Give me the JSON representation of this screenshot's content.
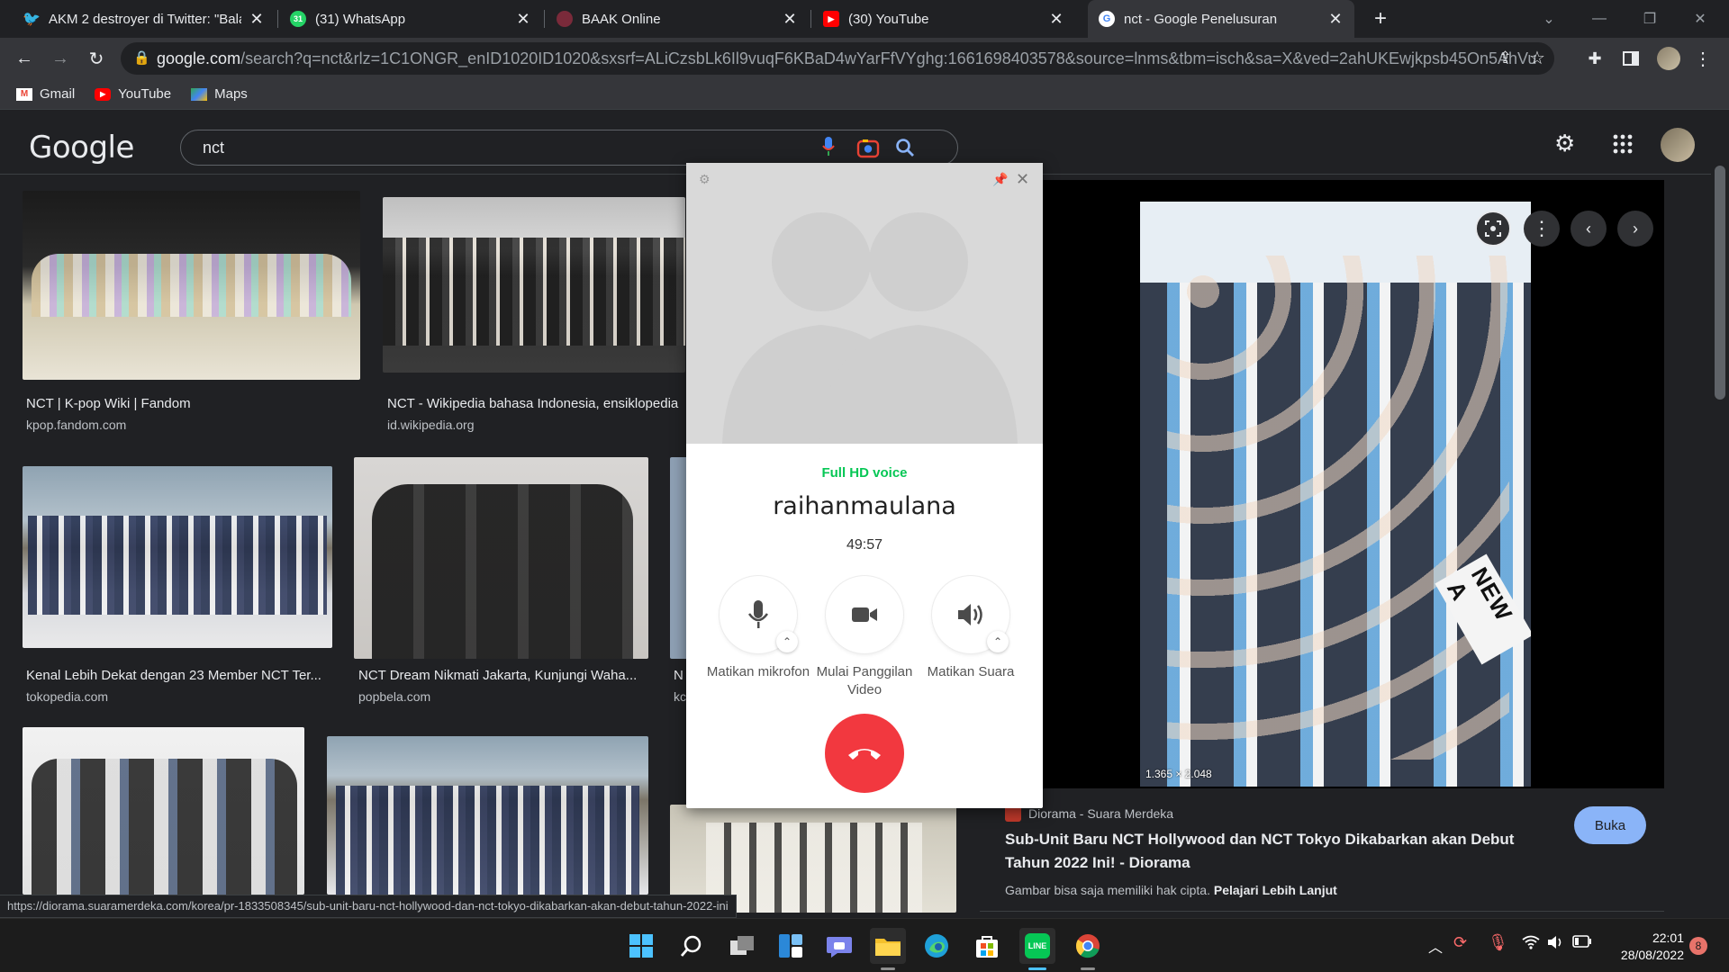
{
  "tabs": [
    {
      "title": "AKM 2 destroyer di Twitter: \"Bala",
      "favicon": "twitter-icon",
      "color": "#1d9bf0"
    },
    {
      "title": "(31) WhatsApp",
      "favicon": "whatsapp-icon",
      "color": "#25d366",
      "badge": "31"
    },
    {
      "title": "BAAK Online",
      "favicon": "baak-icon",
      "color": "#c0392b"
    },
    {
      "title": "(30) YouTube",
      "favicon": "youtube-icon",
      "color": "#ff0000"
    },
    {
      "title": "nct - Google Penelusuran",
      "favicon": "google-icon",
      "color": "#ffffff"
    }
  ],
  "address": {
    "host": "google.com",
    "path": "/search?q=nct&rlz=1C1ONGR_enID1020ID1020&sxsrf=ALiCzsbLk6Il9vuqF6KBaD4wYarFfVYghg:1661698403578&source=lnms&tbm=isch&sa=X&ved=2ahUKEwjkpsb45On5AhVu..."
  },
  "bookmarks": [
    "Gmail",
    "YouTube",
    "Maps"
  ],
  "google": {
    "logo": "Google",
    "query": "nct"
  },
  "results": [
    {
      "title": "NCT | K-pop Wiki | Fandom",
      "source": "kpop.fandom.com"
    },
    {
      "title": "NCT - Wikipedia bahasa Indonesia, ensiklopedia",
      "source": "id.wikipedia.org"
    },
    {
      "title": "Kenal Lebih Dekat dengan 23 Member NCT Ter...",
      "source": "tokopedia.com"
    },
    {
      "title": "NCT Dream Nikmati Jakarta, Kunjungi Waha...",
      "source": "popbela.com"
    },
    {
      "title": "N",
      "source": "kc"
    }
  ],
  "preview": {
    "dimensions": "1.365 × 2.048",
    "site": "Diorama - Suara Merdeka",
    "title": "Sub-Unit Baru NCT Hollywood dan NCT Tokyo Dikabarkan akan Debut Tahun 2022 Ini! - Diorama",
    "open_label": "Buka",
    "copyright_text": "Gambar bisa saja memiliki hak cipta.",
    "learn_more": "Pelajari Lebih Lanjut",
    "banner_text": "NEW A"
  },
  "call": {
    "quality": "Full HD voice",
    "name": "raihanmaulana",
    "duration": "49:57",
    "mute_label": "Matikan mikrofon",
    "video_label": "Mulai Panggilan Video",
    "speaker_label": "Matikan Suara",
    "end_color": "#f2383f",
    "quality_color": "#06c755"
  },
  "status_url": "https://diorama.suaramerdeka.com/korea/pr-1833508345/sub-unit-baru-nct-hollywood-dan-nct-tokyo-dikabarkan-akan-debut-tahun-2022-ini",
  "taskbar": {
    "time": "22:01",
    "date": "28/08/2022",
    "notif_count": "8",
    "apps": [
      "windows-start-icon",
      "search-icon",
      "task-view-icon",
      "widgets-icon",
      "teams-chat-icon",
      "file-explorer-icon",
      "edge-icon",
      "store-icon",
      "line-icon",
      "chrome-icon"
    ]
  }
}
